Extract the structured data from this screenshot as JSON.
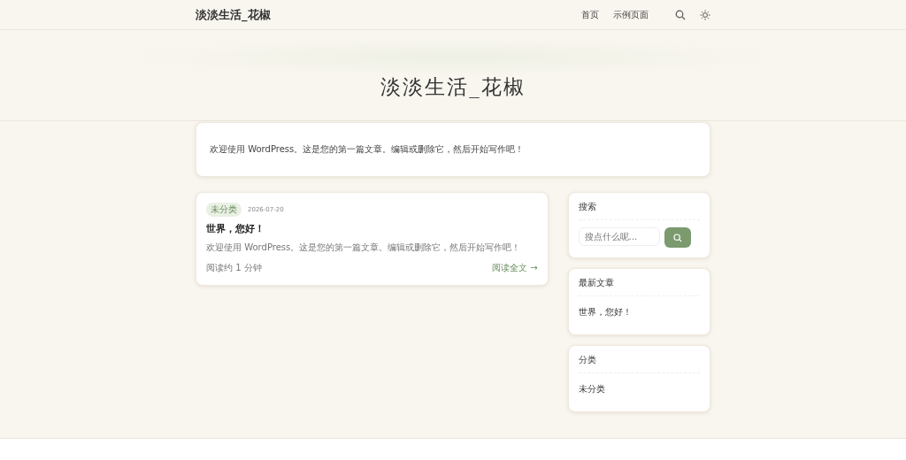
{
  "site_title": "淡淡生活_花椒",
  "nav": [
    {
      "label": "首页"
    },
    {
      "label": "示例页面"
    }
  ],
  "hero_title": "淡淡生活_花椒",
  "intro": "欢迎使用 WordPress。这是您的第一篇文章。编辑或删除它，然后开始写作吧！",
  "posts": [
    {
      "category": "未分类",
      "date": "2026-07-20",
      "title": "世界，您好！",
      "excerpt": "欢迎使用 WordPress。这是您的第一篇文章。编辑或删除它，然后开始写作吧！",
      "read_time": "阅读约 1 分钟",
      "read_more": "阅读全文 →"
    }
  ],
  "sidebar": [
    {
      "kind": "search",
      "title": "搜索",
      "placeholder": "搜点什么呢..."
    },
    {
      "kind": "list",
      "title": "最新文章",
      "items": [
        "世界，您好！"
      ]
    },
    {
      "kind": "list",
      "title": "分类",
      "items": [
        "未分类"
      ]
    }
  ]
}
